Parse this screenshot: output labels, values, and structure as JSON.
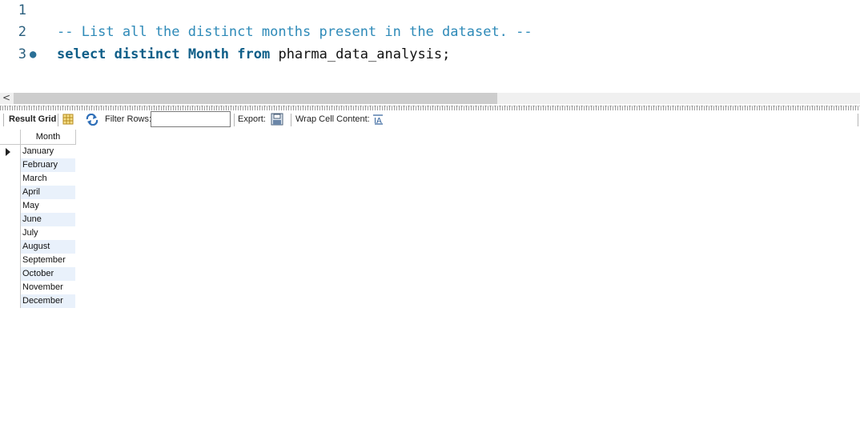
{
  "editor": {
    "lines": [
      {
        "num": "1",
        "text": ""
      },
      {
        "num": "2",
        "comment": "-- List all the distinct months present in the dataset. --"
      },
      {
        "num": "3",
        "kw1": "select",
        "kw2": "distinct",
        "kw3": "Month",
        "kw4": "from",
        "ident": "pharma_data_analysis;"
      }
    ]
  },
  "toolbar": {
    "result_grid": "Result Grid",
    "filter_label": "Filter Rows:",
    "filter_value": "",
    "export_label": "Export:",
    "wrap_label": "Wrap Cell Content:",
    "icons": [
      "grid-icon",
      "refresh-icon",
      "export-icon",
      "wrap-icon"
    ]
  },
  "grid": {
    "column": "Month",
    "rows": [
      "January",
      "February",
      "March",
      "April",
      "May",
      "June",
      "July",
      "August",
      "September",
      "October",
      "November",
      "December"
    ]
  },
  "colors": {
    "keyword": "#0e5e88",
    "comment": "#2e8ab8",
    "alt_row": "#e9f1fb"
  }
}
